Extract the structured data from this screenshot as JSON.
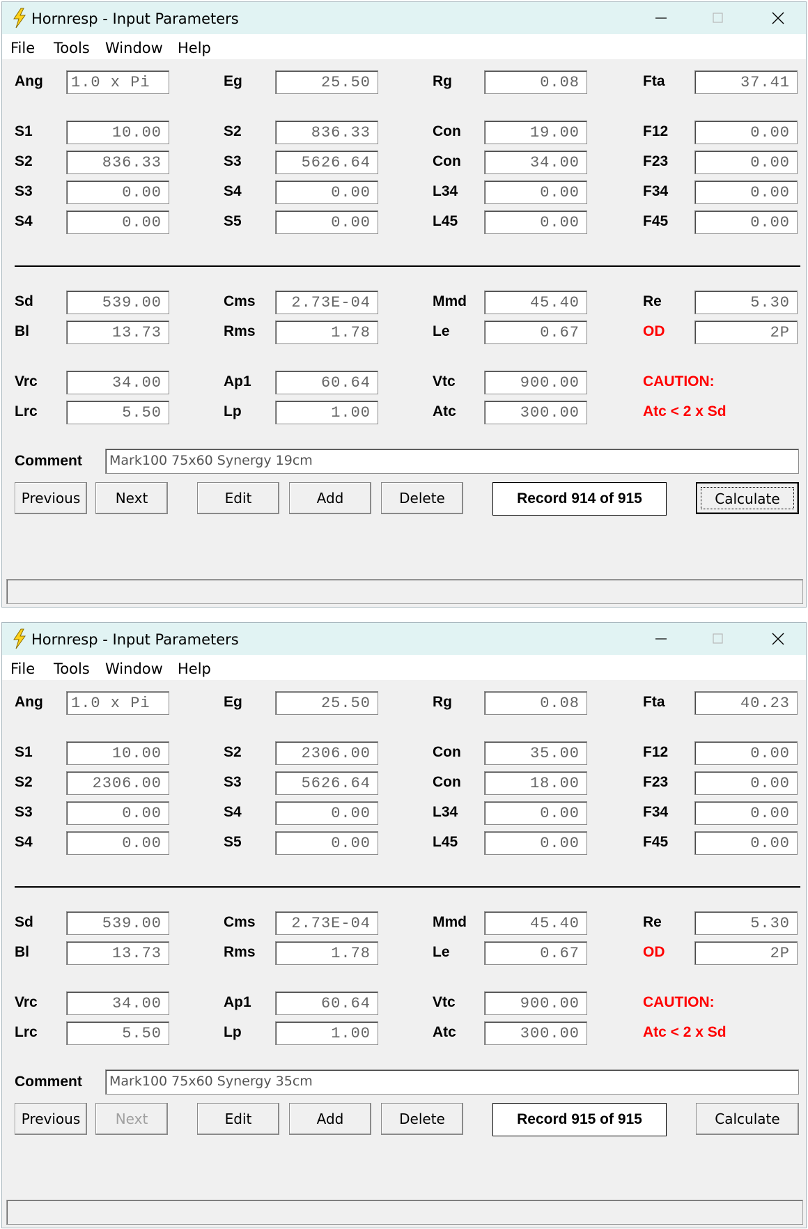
{
  "windows": [
    {
      "title": "Hornresp - Input Parameters",
      "menu": [
        "File",
        "Tools",
        "Window",
        "Help"
      ],
      "row1": {
        "Ang": "1.0 x Pi",
        "Eg": "25.50",
        "Rg": "0.08",
        "Fta": "37.41"
      },
      "seg": [
        [
          "S1",
          "10.00",
          "S2",
          "836.33",
          "Con",
          "19.00",
          "F12",
          "0.00"
        ],
        [
          "S2",
          "836.33",
          "S3",
          "5626.64",
          "Con",
          "34.00",
          "F23",
          "0.00"
        ],
        [
          "S3",
          "0.00",
          "S4",
          "0.00",
          "L34",
          "0.00",
          "F34",
          "0.00"
        ],
        [
          "S4",
          "0.00",
          "S5",
          "0.00",
          "L45",
          "0.00",
          "F45",
          "0.00"
        ]
      ],
      "driver": [
        [
          "Sd",
          "539.00",
          "Cms",
          "2.73E-04",
          "Mmd",
          "45.40",
          "Re",
          "5.30"
        ],
        [
          "Bl",
          "13.73",
          "Rms",
          "1.78",
          "Le",
          "0.67",
          "OD",
          "2P"
        ]
      ],
      "chamber": [
        [
          "Vrc",
          "34.00",
          "Ap1",
          "60.64",
          "Vtc",
          "900.00"
        ],
        [
          "Lrc",
          "5.50",
          "Lp",
          "1.00",
          "Atc",
          "300.00"
        ]
      ],
      "caution_title": "CAUTION:",
      "caution_text": "Atc < 2 x Sd",
      "comment_label": "Comment",
      "comment": "Mark100 75x60 Synergy 19cm",
      "buttons": {
        "previous": "Previous",
        "next": "Next",
        "edit": "Edit",
        "add": "Add",
        "delete": "Delete",
        "calculate": "Calculate"
      },
      "next_enabled": true,
      "calculate_focused": true,
      "record": "Record 914 of 915"
    },
    {
      "title": "Hornresp - Input Parameters",
      "menu": [
        "File",
        "Tools",
        "Window",
        "Help"
      ],
      "row1": {
        "Ang": "1.0 x Pi",
        "Eg": "25.50",
        "Rg": "0.08",
        "Fta": "40.23"
      },
      "seg": [
        [
          "S1",
          "10.00",
          "S2",
          "2306.00",
          "Con",
          "35.00",
          "F12",
          "0.00"
        ],
        [
          "S2",
          "2306.00",
          "S3",
          "5626.64",
          "Con",
          "18.00",
          "F23",
          "0.00"
        ],
        [
          "S3",
          "0.00",
          "S4",
          "0.00",
          "L34",
          "0.00",
          "F34",
          "0.00"
        ],
        [
          "S4",
          "0.00",
          "S5",
          "0.00",
          "L45",
          "0.00",
          "F45",
          "0.00"
        ]
      ],
      "driver": [
        [
          "Sd",
          "539.00",
          "Cms",
          "2.73E-04",
          "Mmd",
          "45.40",
          "Re",
          "5.30"
        ],
        [
          "Bl",
          "13.73",
          "Rms",
          "1.78",
          "Le",
          "0.67",
          "OD",
          "2P"
        ]
      ],
      "chamber": [
        [
          "Vrc",
          "34.00",
          "Ap1",
          "60.64",
          "Vtc",
          "900.00"
        ],
        [
          "Lrc",
          "5.50",
          "Lp",
          "1.00",
          "Atc",
          "300.00"
        ]
      ],
      "caution_title": "CAUTION:",
      "caution_text": "Atc < 2 x Sd",
      "comment_label": "Comment",
      "comment": "Mark100 75x60 Synergy 35cm",
      "buttons": {
        "previous": "Previous",
        "next": "Next",
        "edit": "Edit",
        "add": "Add",
        "delete": "Delete",
        "calculate": "Calculate"
      },
      "next_enabled": false,
      "calculate_focused": false,
      "record": "Record 915 of 915"
    }
  ],
  "colors": {
    "titlebar": "#e1f3f3",
    "window_bg": "#f0f0f0",
    "warning_red": "#ff0000",
    "field_text": "#666666"
  },
  "icons": [
    "hornresp-lightning-icon",
    "minimize-icon",
    "maximize-icon",
    "close-icon"
  ]
}
